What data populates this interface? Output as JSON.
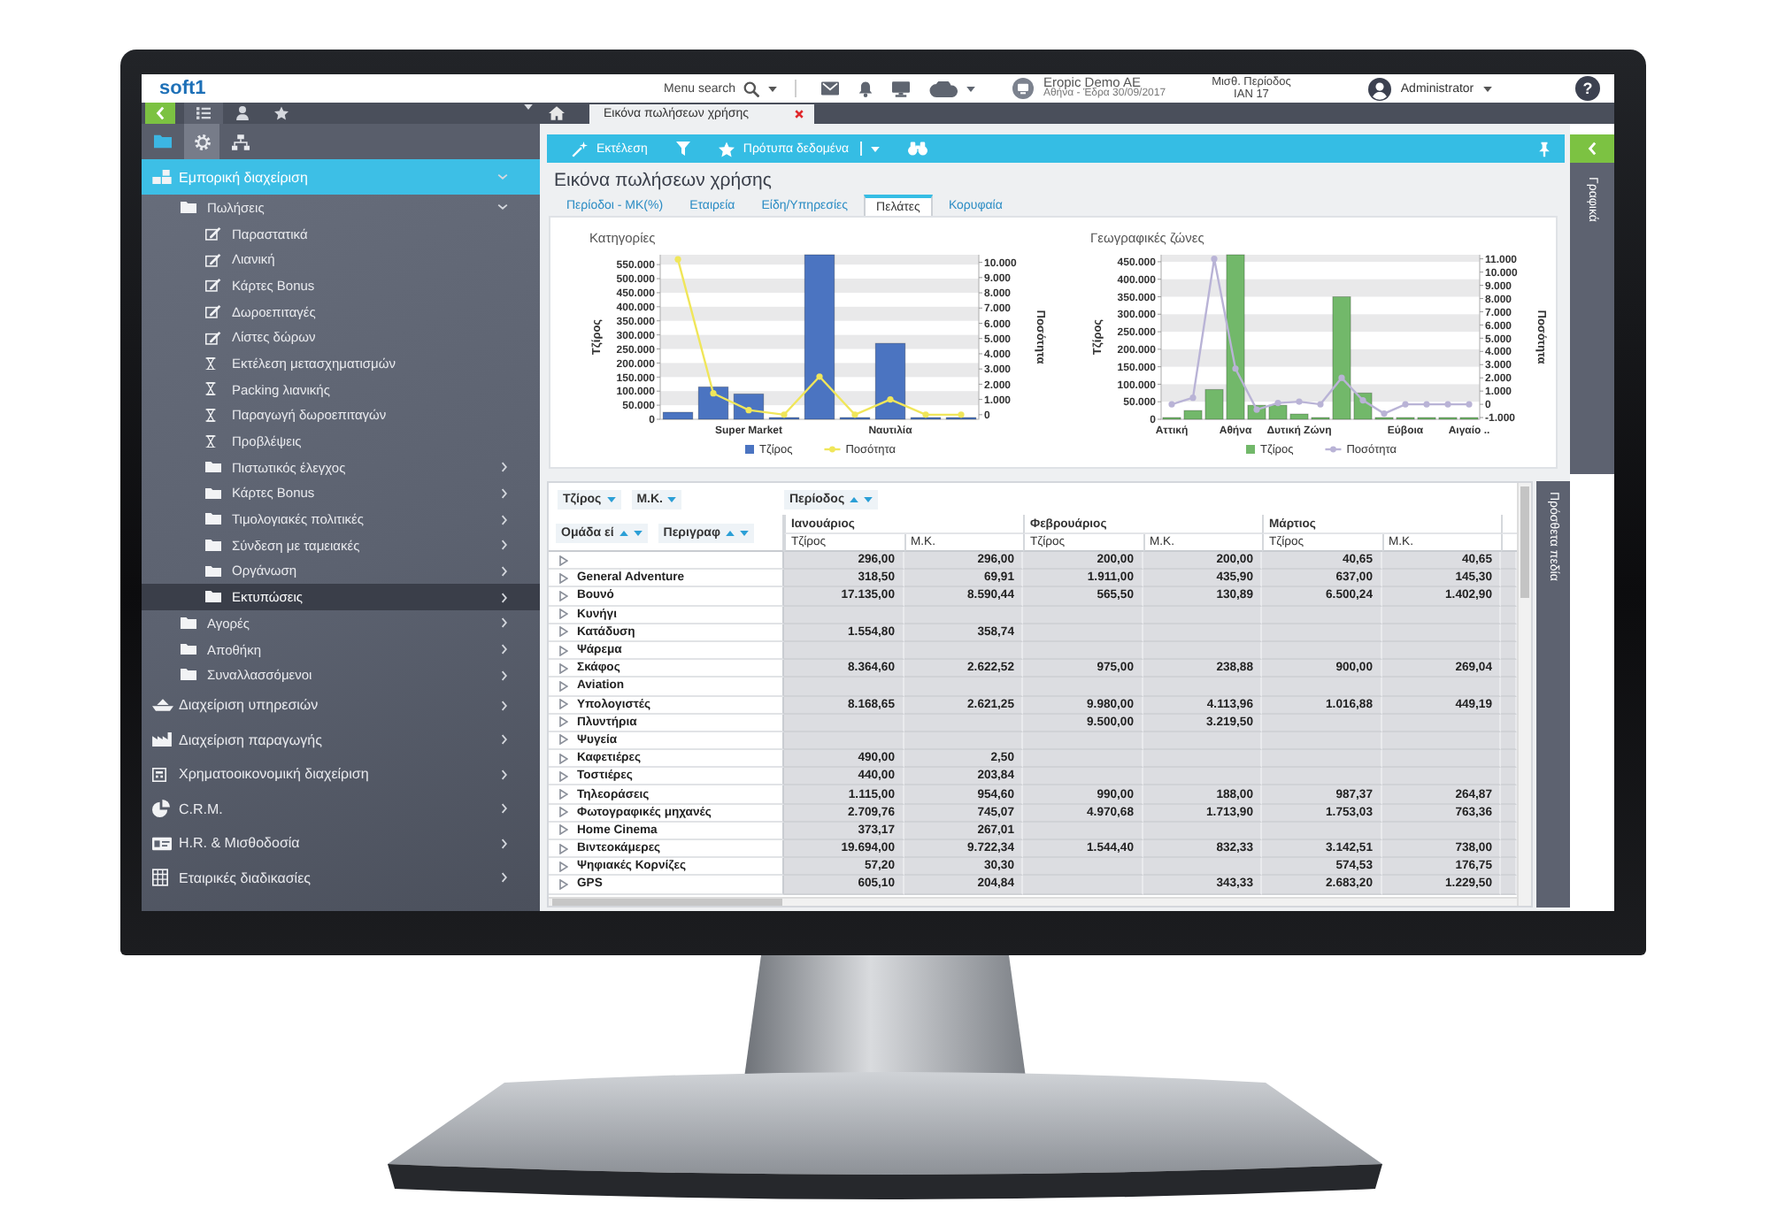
{
  "top_bar": {
    "logo": "soft1",
    "search_label": "Menu search",
    "company": "Eropic Demo AE",
    "company_detail": "Αθήνα - Έδρα 30/09/2017",
    "period_label": "Μισθ. Περίοδος",
    "period_value": "ΙΑΝ 17",
    "user": "Administrator",
    "help": "?"
  },
  "sidebar": {
    "header_tabs": [
      {
        "selected": true
      },
      {
        "selected": false
      },
      {
        "selected": false
      }
    ],
    "icon_tabs": [
      {
        "selected": false
      },
      {
        "selected": true
      },
      {
        "selected": false
      }
    ],
    "items": [
      {
        "label": "Εμπορική διαχείριση",
        "kind": "module",
        "expanded": true,
        "selected": false,
        "children": [
          {
            "label": "Πωλήσεις",
            "kind": "folder",
            "expanded": true,
            "selected": false,
            "children": [
              {
                "label": "Παραστατικά",
                "kind": "form",
                "selected": false
              },
              {
                "label": "Λιανική",
                "kind": "form",
                "selected": false
              },
              {
                "label": "Κάρτες Bonus",
                "kind": "form",
                "selected": false
              },
              {
                "label": "Δωροεπιταγές",
                "kind": "form",
                "selected": false
              },
              {
                "label": "Λίστες δώρων",
                "kind": "form",
                "selected": false
              },
              {
                "label": "Εκτέλεση μετασχηματισμών",
                "kind": "task",
                "selected": false
              },
              {
                "label": "Packing λιανικής",
                "kind": "task",
                "selected": false
              },
              {
                "label": "Παραγωγή δωροεπιταγών",
                "kind": "task",
                "selected": false
              },
              {
                "label": "Προβλέψεις",
                "kind": "task",
                "selected": false
              },
              {
                "label": "Πιστωτικός έλεγχος",
                "kind": "folder",
                "expanded": false,
                "selected": false
              },
              {
                "label": "Κάρτες Bonus",
                "kind": "folder",
                "expanded": false,
                "selected": false
              },
              {
                "label": "Τιμολογιακές πολιτικές",
                "kind": "folder",
                "expanded": false,
                "selected": false
              },
              {
                "label": "Σύνδεση με ταμειακές",
                "kind": "folder",
                "expanded": false,
                "selected": false
              },
              {
                "label": "Οργάνωση",
                "kind": "folder",
                "expanded": false,
                "selected": false
              },
              {
                "label": "Εκτυπώσεις",
                "kind": "folder",
                "expanded": false,
                "selected": true
              }
            ]
          },
          {
            "label": "Αγορές",
            "kind": "folder",
            "expanded": false,
            "selected": false
          },
          {
            "label": "Αποθήκη",
            "kind": "folder",
            "expanded": false,
            "selected": false
          },
          {
            "label": "Συναλλασσόμενοι",
            "kind": "folder",
            "expanded": false,
            "selected": false
          }
        ]
      },
      {
        "label": "Διαχείριση υπηρεσιών",
        "kind": "module",
        "expanded": false,
        "selected": false
      },
      {
        "label": "Διαχείριση παραγωγής",
        "kind": "module",
        "expanded": false,
        "selected": false
      },
      {
        "label": "Χρηματοοικονομική διαχείριση",
        "kind": "module",
        "expanded": false,
        "selected": false
      },
      {
        "label": "C.R.M.",
        "kind": "module",
        "expanded": false,
        "selected": false
      },
      {
        "label": "H.R. & Μισθοδοσία",
        "kind": "module",
        "expanded": false,
        "selected": false
      },
      {
        "label": "Εταιρικές διαδικασίες",
        "kind": "module",
        "expanded": false,
        "selected": false
      }
    ]
  },
  "document_tabs": [
    {
      "label": "Εικόνα πωλήσεων χρήσης",
      "selected": true
    }
  ],
  "toolbar": {
    "run_label": "Εκτέλεση",
    "templates_label": "Πρότυπα δεδομένα"
  },
  "page": {
    "title": "Εικόνα πωλήσεων χρήσης",
    "tabs": [
      {
        "label": "Περίοδοι - ΜΚ(%)",
        "selected": false
      },
      {
        "label": "Εταιρεία",
        "selected": false
      },
      {
        "label": "Είδη/Υπηρεσίες",
        "selected": false
      },
      {
        "label": "Πελάτες",
        "selected": true
      },
      {
        "label": "Κορυφαία",
        "selected": false
      }
    ],
    "charts": [
      {
        "turnover": {
          "chart_data": {
            "type": "bar",
            "title": "Κατηγορίες",
            "ylabel": "Τζίρος",
            "categories": [
              null,
              null,
              "Super Market",
              null,
              null,
              null,
              "Ναυτιλία",
              null,
              null
            ],
            "ylim": [
              0,
              585000
            ],
            "yticks": [
              {
                "value": 0,
                "label": "0"
              },
              {
                "value": 50000,
                "label": "50.000"
              },
              {
                "value": 100000,
                "label": "100.000"
              },
              {
                "value": 150000,
                "label": "150.000"
              },
              {
                "value": 200000,
                "label": "200.000"
              },
              {
                "value": 250000,
                "label": "250.000"
              },
              {
                "value": 300000,
                "label": "300.000"
              },
              {
                "value": 350000,
                "label": "350.000"
              },
              {
                "value": 400000,
                "label": "400.000"
              },
              {
                "value": 450000,
                "label": "450.000"
              },
              {
                "value": 500000,
                "label": "500.000"
              },
              {
                "value": 550000,
                "label": "550.000"
              }
            ],
            "series": [
              {
                "name": "Τζίρος",
                "color": "#4b74c1",
                "values": [
                  25000,
                  115000,
                  90000,
                  5000,
                  585000,
                  5000,
                  270000,
                  5000,
                  5000
                ]
              }
            ]
          }
        },
        "quantity": {
          "chart_data": {
            "type": "line",
            "ylabel": "Ποσότητα",
            "categories": [
              null,
              null,
              null,
              null,
              null,
              null,
              null,
              null,
              null
            ],
            "ylim": [
              -300,
              10500
            ],
            "yticks": [
              {
                "value": 0,
                "label": "0"
              },
              {
                "value": 1000,
                "label": "1.000"
              },
              {
                "value": 2000,
                "label": "2.000"
              },
              {
                "value": 3000,
                "label": "3.000"
              },
              {
                "value": 4000,
                "label": "4.000"
              },
              {
                "value": 5000,
                "label": "5.000"
              },
              {
                "value": 6000,
                "label": "6.000"
              },
              {
                "value": 7000,
                "label": "7.000"
              },
              {
                "value": 8000,
                "label": "8.000"
              },
              {
                "value": 9000,
                "label": "9.000"
              },
              {
                "value": 10000,
                "label": "10.000"
              }
            ],
            "series": [
              {
                "name": "Ποσότητα",
                "color": "#f0e65a",
                "marker": "circle",
                "values": [
                  10200,
                  1400,
                  300,
                  0,
                  2500,
                  0,
                  1000,
                  0,
                  0
                ]
              }
            ]
          }
        }
      },
      {
        "turnover": {
          "chart_data": {
            "type": "bar",
            "title": "Γεωγραφικές ζώνες",
            "ylabel": "Τζίρος",
            "categories": [
              "Αττική",
              null,
              null,
              "Αθήνα",
              null,
              null,
              "Δυτική Ζώνη",
              null,
              null,
              null,
              null,
              "Εύβοια",
              null,
              null,
              "Αιγαίο .."
            ],
            "ylim": [
              0,
              470000
            ],
            "yticks": [
              {
                "value": 0,
                "label": "0"
              },
              {
                "value": 50000,
                "label": "50.000"
              },
              {
                "value": 100000,
                "label": "100.000"
              },
              {
                "value": 150000,
                "label": "150.000"
              },
              {
                "value": 200000,
                "label": "200.000"
              },
              {
                "value": 250000,
                "label": "250.000"
              },
              {
                "value": 300000,
                "label": "300.000"
              },
              {
                "value": 350000,
                "label": "350.000"
              },
              {
                "value": 400000,
                "label": "400.000"
              },
              {
                "value": 450000,
                "label": "450.000"
              }
            ],
            "series": [
              {
                "name": "Τζίρος",
                "color": "#72b86a",
                "values": [
                  2000,
                  25000,
                  85000,
                  470000,
                  40000,
                  40000,
                  15000,
                  3000,
                  350000,
                  75000,
                  3000,
                  3000,
                  5000,
                  5000,
                  3000
                ]
              }
            ]
          }
        },
        "quantity": {
          "chart_data": {
            "type": "line",
            "ylabel": "Ποσότητα",
            "categories": [
              null,
              null,
              null,
              null,
              null,
              null,
              null,
              null,
              null,
              null,
              null,
              null,
              null,
              null,
              null
            ],
            "ylim": [
              -1130,
              11310
            ],
            "yticks": [
              {
                "value": -1000,
                "label": "-1.000"
              },
              {
                "value": 0,
                "label": "0"
              },
              {
                "value": 1000,
                "label": "1.000"
              },
              {
                "value": 2000,
                "label": "2.000"
              },
              {
                "value": 3000,
                "label": "3.000"
              },
              {
                "value": 4000,
                "label": "4.000"
              },
              {
                "value": 5000,
                "label": "5.000"
              },
              {
                "value": 6000,
                "label": "6.000"
              },
              {
                "value": 7000,
                "label": "7.000"
              },
              {
                "value": 8000,
                "label": "8.000"
              },
              {
                "value": 9000,
                "label": "9.000"
              },
              {
                "value": 10000,
                "label": "10.000"
              },
              {
                "value": 11000,
                "label": "11.000"
              }
            ],
            "series": [
              {
                "name": "Ποσότητα",
                "color": "#b9b3d6",
                "marker": "circle",
                "values": [
                  0,
                  500,
                  11000,
                  2700,
                  -400,
                  100,
                  200,
                  0,
                  2000,
                  300,
                  -700,
                  0,
                  0,
                  0,
                  0
                ]
              }
            ]
          }
        }
      }
    ],
    "pivot": {
      "data_fields": [
        {
          "label": "Τζίρος"
        },
        {
          "label": "Μ.Κ."
        }
      ],
      "column_fields": [
        {
          "label": "Περίοδος"
        }
      ],
      "row_fields": [
        {
          "label": "Ομάδα εί"
        },
        {
          "label": "Περιγραφ"
        }
      ],
      "columns": [
        {
          "label": "Ιανουάριος",
          "measures": [
            "Τζίρος",
            "Μ.Κ."
          ]
        },
        {
          "label": "Φεβρουάριος",
          "measures": [
            "Τζίρος",
            "Μ.Κ."
          ]
        },
        {
          "label": "Μάρτιος",
          "measures": [
            "Τζίρος",
            "Μ.Κ."
          ]
        }
      ],
      "rows": [
        {
          "cells": [
            "296,00",
            "296,00",
            "200,00",
            "200,00",
            "40,65",
            "40,65"
          ]
        },
        {
          "label": "General Adventure",
          "cells": [
            "318,50",
            "69,91",
            "1.911,00",
            "435,90",
            "637,00",
            "145,30"
          ]
        },
        {
          "label": "Βουνό",
          "cells": [
            "17.135,00",
            "8.590,44",
            "565,50",
            "130,89",
            "6.500,24",
            "1.402,90"
          ]
        },
        {
          "label": "Κυνήγι"
        },
        {
          "label": "Κατάδυση",
          "cells": [
            "1.554,80",
            "358,74"
          ]
        },
        {
          "label": "Ψάρεμα"
        },
        {
          "label": "Σκάφος",
          "cells": [
            "8.364,60",
            "2.622,52",
            "975,00",
            "238,88",
            "900,00",
            "269,04"
          ]
        },
        {
          "label": "Aviation"
        },
        {
          "label": "Υπολογιστές",
          "cells": [
            "8.168,65",
            "2.621,25",
            "9.980,00",
            "4.113,96",
            "1.016,88",
            "449,19"
          ]
        },
        {
          "label": "Πλυντήρια",
          "cells": [
            null,
            null,
            "9.500,00",
            "3.219,50"
          ]
        },
        {
          "label": "Ψυγεία"
        },
        {
          "label": "Καφετιέρες",
          "cells": [
            "490,00",
            "2,50"
          ]
        },
        {
          "label": "Τοστιέρες",
          "cells": [
            "440,00",
            "203,84"
          ]
        },
        {
          "label": "Τηλεοράσεις",
          "cells": [
            "1.115,00",
            "954,60",
            "990,00",
            "188,00",
            "987,37",
            "264,87"
          ]
        },
        {
          "label": "Φωτογραφικές μηχανές",
          "cells": [
            "2.709,76",
            "745,07",
            "4.970,68",
            "1.713,90",
            "1.753,03",
            "763,36"
          ]
        },
        {
          "label": "Home Cinema",
          "cells": [
            "373,17",
            "267,01"
          ]
        },
        {
          "label": "Βιντεοκάμερες",
          "cells": [
            "19.694,00",
            "9.722,34",
            "1.544,40",
            "832,33",
            "3.142,51",
            "738,00"
          ]
        },
        {
          "label": "Ψηφιακές Κορνίζες",
          "cells": [
            "57,20",
            "30,30",
            null,
            null,
            "574,53",
            "176,75"
          ]
        },
        {
          "label": "GPS",
          "cells": [
            "605,10",
            "204,84",
            null,
            "343,33",
            "2.683,20",
            "1.229,50"
          ]
        }
      ]
    }
  },
  "extra_fields_panel": {
    "label": "Πρόσθετα πεδία"
  },
  "charts_panel": {
    "label": "Γραφικά"
  }
}
